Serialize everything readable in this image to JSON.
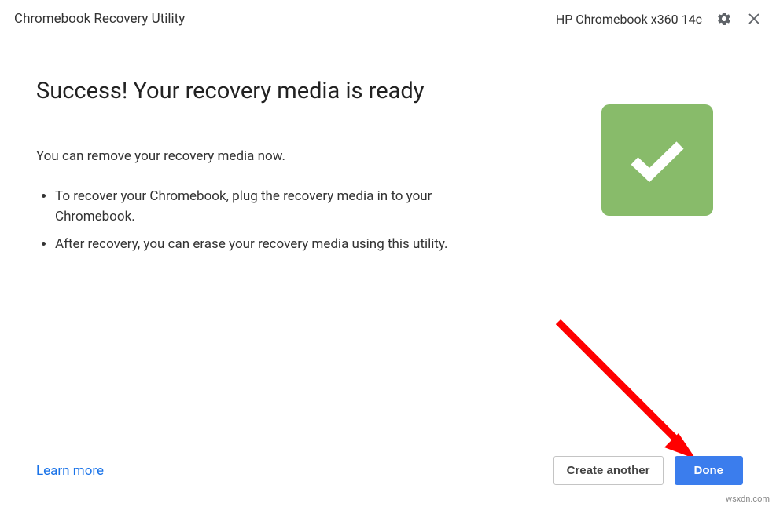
{
  "header": {
    "title": "Chromebook Recovery Utility",
    "device": "HP Chromebook x360 14c"
  },
  "main": {
    "heading": "Success! Your recovery media is ready",
    "intro": "You can remove your recovery media now.",
    "bullets": [
      "To recover your Chromebook, plug the recovery media in to your Chromebook.",
      "After recovery, you can erase your recovery media using this utility."
    ]
  },
  "footer": {
    "learn_more": "Learn more",
    "create_another": "Create another",
    "done": "Done"
  },
  "watermark": "wsxdn.com",
  "icons": {
    "gear": "gear-icon",
    "close": "close-icon",
    "check": "check-icon"
  },
  "colors": {
    "primary": "#3b7ded",
    "success_tile": "#88bb6a",
    "link": "#1a73e8",
    "arrow": "#ff0000"
  }
}
